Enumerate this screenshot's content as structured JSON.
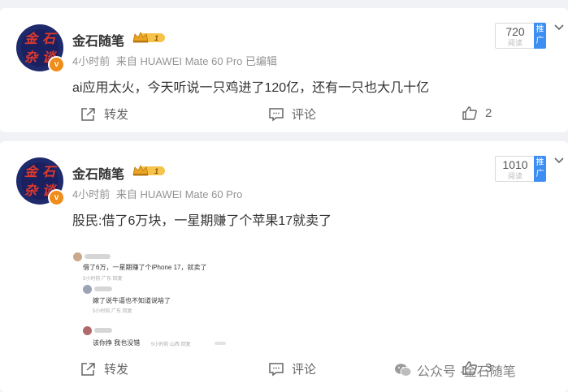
{
  "colors": {
    "accent": "#3c8ef2",
    "badge": "#f08c1a",
    "avatar_bg": "#1b2060",
    "avatar_text": "#e03a2c"
  },
  "posts": [
    {
      "author": "金石随笔",
      "avatar_chars": [
        "金",
        "石",
        "杂",
        "谈"
      ],
      "level": "1",
      "meta_time": "4小时前",
      "meta_source": "来自 HUAWEI Mate 60 Pro 已编辑",
      "text": "ai应用太火，今天听说一只鸡进了120亿，还有一只也大几十亿",
      "reads": "720",
      "reads_label": "阅读",
      "promote_label": "推广",
      "repost_label": "转发",
      "comment_label": "评论",
      "like_count": "2"
    },
    {
      "author": "金石随笔",
      "avatar_chars": [
        "金",
        "石",
        "杂",
        "谈"
      ],
      "level": "1",
      "meta_time": "4小时前",
      "meta_source": "来自 HUAWEI Mate 60 Pro",
      "text": "股民:借了6万块，一星期赚了个苹果17就卖了",
      "reads": "1010",
      "reads_label": "阅读",
      "promote_label": "推广",
      "repost_label": "转发",
      "comment_label": "评论",
      "like_count": "3",
      "screenshot": {
        "line1": "借了6万，一星期赚了个iPhone 17，就卖了",
        "line1_meta": "5小时前 广东 回复",
        "line2": "嫁了说牛逼也不知道说啥了",
        "line2_meta": "5小时前 广东 回复",
        "line3": "该你挣   我也没错",
        "line3_meta": "5小时前 山西 回复"
      }
    }
  ],
  "watermark": {
    "prefix": "公众号 · ",
    "name": "金石随笔"
  },
  "icons": {
    "repost": "share-icon",
    "comment": "comment-icon",
    "like": "thumbs-up-icon",
    "more": "chevron-down-icon"
  }
}
